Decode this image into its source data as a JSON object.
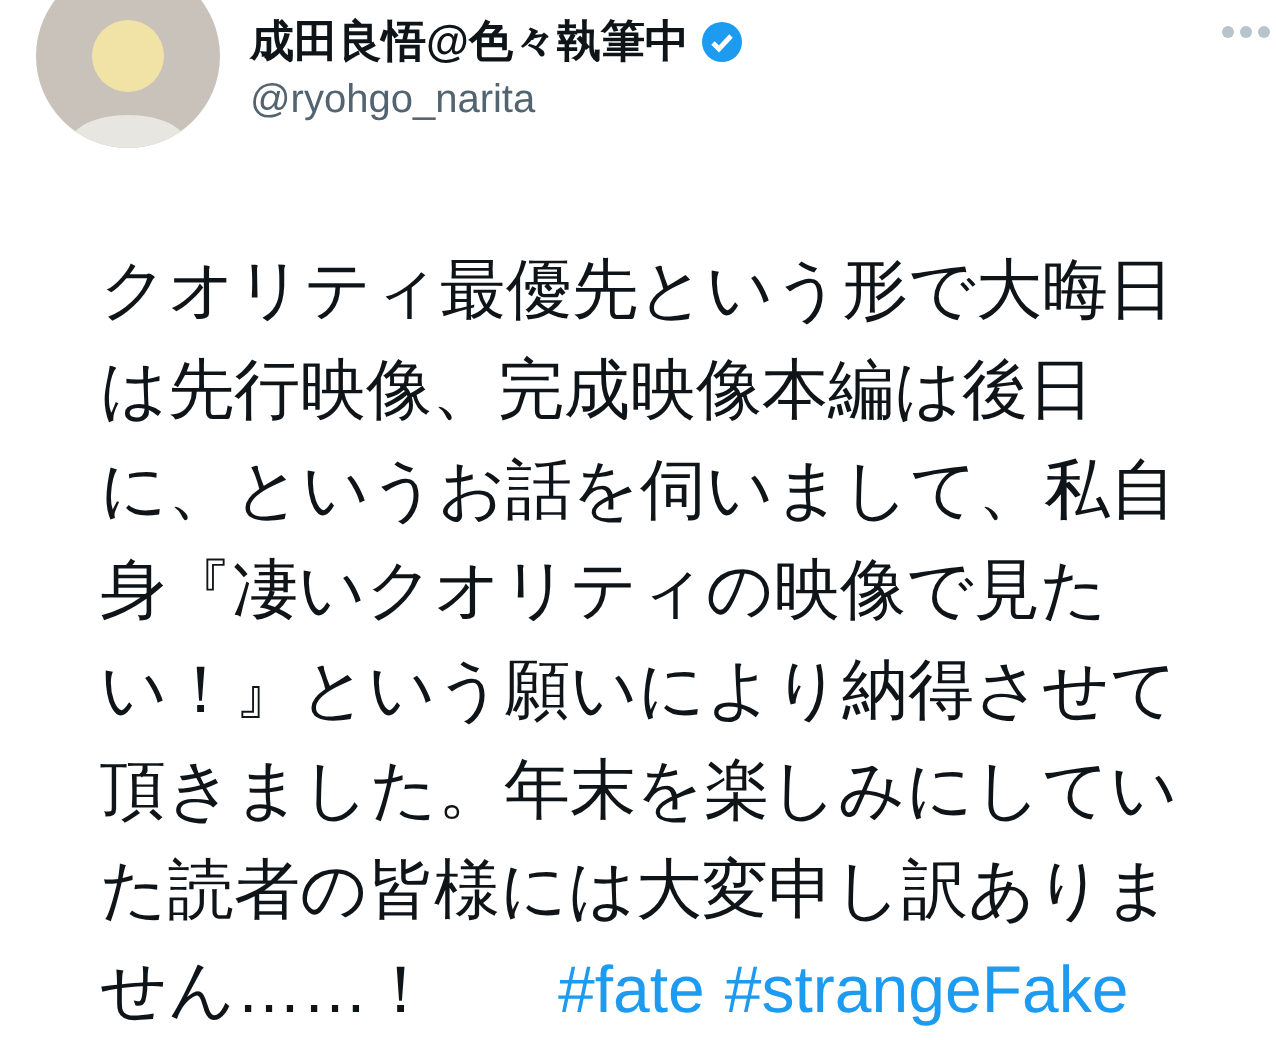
{
  "author": {
    "name": "成田良悟@色々執筆中",
    "verified": true,
    "handle": "@ryohgo_narita"
  },
  "tweet": {
    "lines": [
      "クオリティ最優先という形で大晦日",
      "は先行映像、完成映像本編は後日",
      "に、というお話を伺いまして、私自",
      "身『凄いクオリティの映像で見た",
      "い！』という願いにより納得させて",
      "頂きました。年末を楽しみにしてい",
      "た読者の皆様には大変申し訳ありま",
      "せん……！"
    ],
    "hashtags": [
      "#fate",
      "#strangeFake"
    ]
  }
}
